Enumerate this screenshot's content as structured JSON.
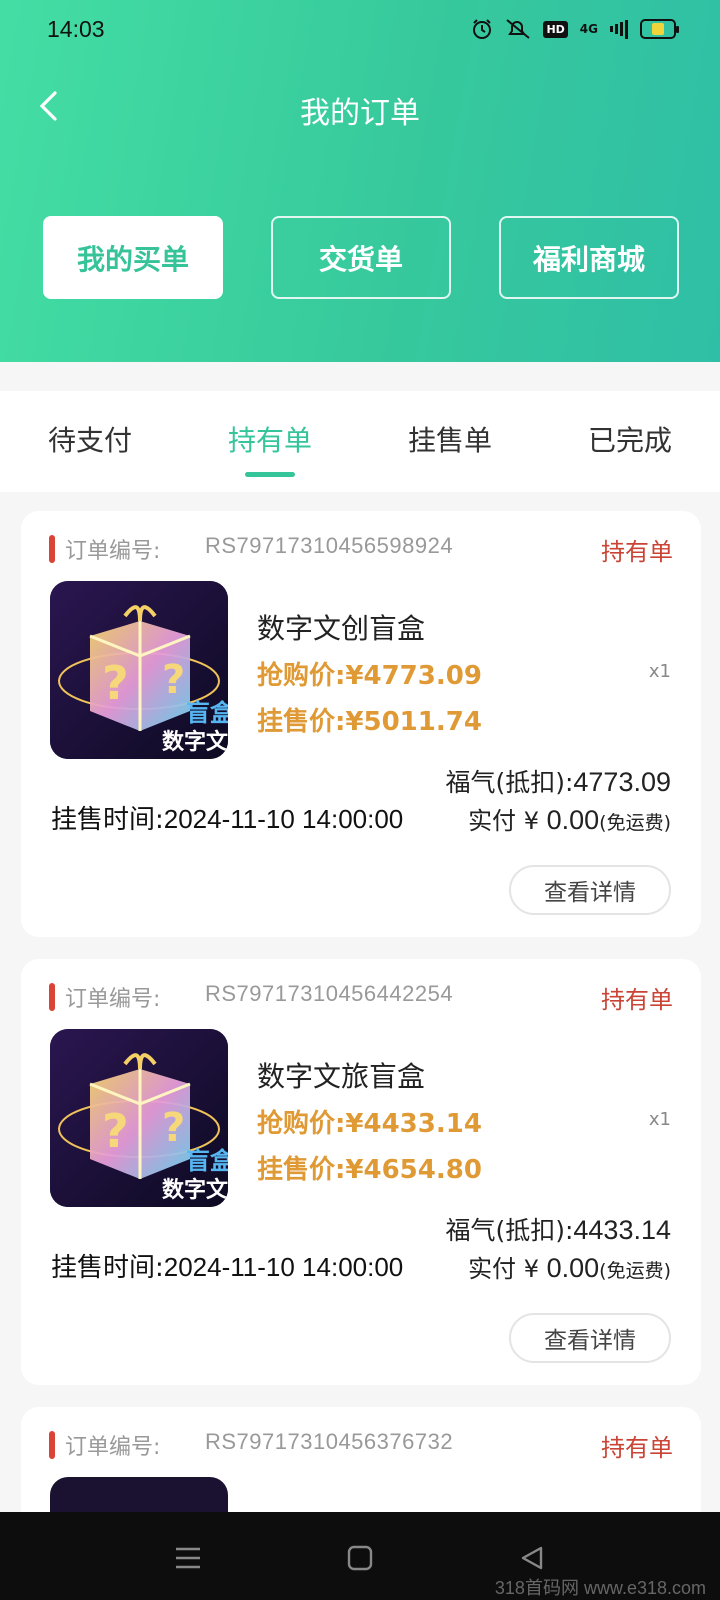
{
  "status_bar": {
    "time": "14:03",
    "network": "4G"
  },
  "header": {
    "title": "我的订单",
    "tabs": [
      "我的买单",
      "交货单",
      "福利商城"
    ],
    "active_tab": "我的买单"
  },
  "status_tabs": {
    "items": [
      "待支付",
      "持有单",
      "挂售单",
      "已完成"
    ],
    "active": "持有单"
  },
  "orders": [
    {
      "order_no_label": "订单编号:",
      "order_no": "RS79717310456598924",
      "status": "持有单",
      "product_name": "数字文创盲盒",
      "image_text": [
        "盲盒",
        "数字文"
      ],
      "buy_price": "抢购价:¥4773.09",
      "sale_price": "挂售价:¥5011.74",
      "quantity": "x1",
      "deduct_label": "福气(抵扣):",
      "deduct_value": "4773.09",
      "paid_label": "实付 ¥",
      "paid_value": "0.00",
      "paid_note": "(免运费)",
      "sale_time_label": "挂售时间:",
      "sale_time": "2024-11-10 14:00:00",
      "detail_button": "查看详情"
    },
    {
      "order_no_label": "订单编号:",
      "order_no": "RS79717310456442254",
      "status": "持有单",
      "product_name": "数字文旅盲盒",
      "image_text": [
        "盲盒",
        "数字文"
      ],
      "buy_price": "抢购价:¥4433.14",
      "sale_price": "挂售价:¥4654.80",
      "quantity": "x1",
      "deduct_label": "福气(抵扣):",
      "deduct_value": "4433.14",
      "paid_label": "实付 ¥",
      "paid_value": "0.00",
      "paid_note": "(免运费)",
      "sale_time_label": "挂售时间:",
      "sale_time": "2024-11-10 14:00:00",
      "detail_button": "查看详情"
    },
    {
      "order_no_label": "订单编号:",
      "order_no": "RS79717310456376732",
      "status": "持有单"
    }
  ],
  "watermark": "318首码网 www.e318.com",
  "colors": {
    "header_start": "#44dea4",
    "header_end": "#2fbfa6",
    "accent": "#36c49b",
    "price": "#e09a35",
    "status_red": "#c94434"
  },
  "icons": {
    "back": "back-arrow-icon",
    "nav_menu": "menu-icon",
    "nav_home": "home-icon",
    "nav_back": "back-triangle-icon"
  }
}
